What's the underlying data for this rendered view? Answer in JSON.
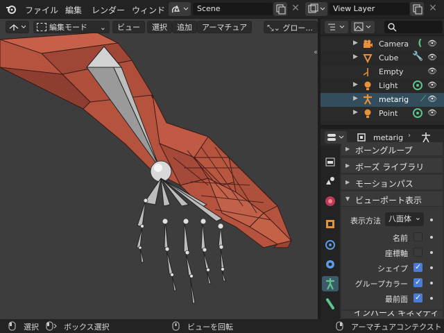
{
  "menubar": {
    "items": [
      "ファイル",
      "編集",
      "レンダー",
      "ウィンド"
    ],
    "scene": "Scene",
    "view_layer": "View Layer"
  },
  "viewport_header": {
    "mode": "編集モード",
    "menus": [
      "ビュー",
      "選択",
      "追加",
      "アーマチュア"
    ],
    "orientation": "グロー..."
  },
  "outliner": {
    "items": [
      {
        "label": "Camera",
        "icon": "camera-icon",
        "color": "#e6923c"
      },
      {
        "label": "Cube",
        "icon": "mesh-icon",
        "color": "#e6923c"
      },
      {
        "label": "Empty",
        "icon": "empty-icon",
        "color": "#e6923c"
      },
      {
        "label": "Light",
        "icon": "light-icon",
        "color": "#e6923c"
      },
      {
        "label": "metarig",
        "icon": "armature-icon",
        "color": "#e6923c"
      },
      {
        "label": "Point",
        "icon": "light-icon",
        "color": "#e6923c"
      }
    ]
  },
  "properties": {
    "object": "metarig",
    "panels": [
      "ボーングループ",
      "ボーズ ライブラリ",
      "モーションパス",
      "ビューポート表示"
    ],
    "display_as_label": "表示方法",
    "display_as_value": "八面体",
    "options": [
      {
        "label": "名前",
        "checked": false
      },
      {
        "label": "座標軸",
        "checked": false
      },
      {
        "label": "シェイプ",
        "checked": true
      },
      {
        "label": "グループカラー",
        "checked": true
      },
      {
        "label": "最前面",
        "checked": true
      }
    ],
    "next_panel": "インバース キネマティ"
  },
  "statusbar": {
    "select": "選択",
    "box_select": "ボックス選択",
    "rotate_view": "ビューを回転",
    "context": "アーマチュアコンテクスト"
  },
  "colors": {
    "accent": "#4a7bd6",
    "selected_row": "#334d5c",
    "mesh": "#b5533f"
  }
}
